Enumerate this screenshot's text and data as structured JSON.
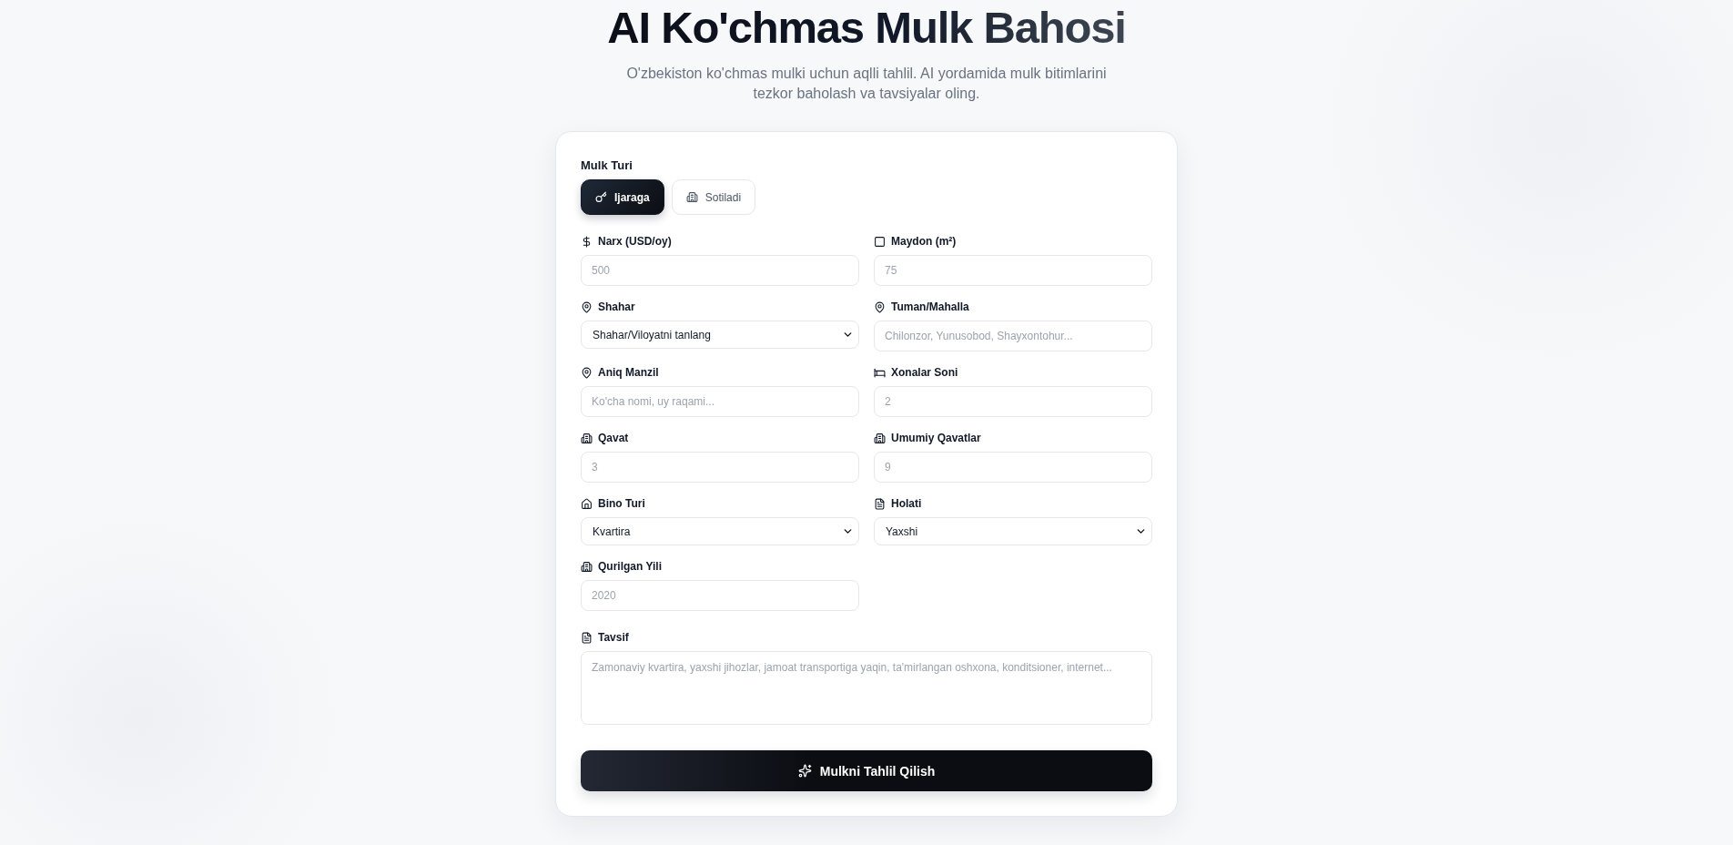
{
  "header": {
    "title": "AI Ko'chmas Mulk Bahosi",
    "subtitle": "O'zbekiston ko'chmas mulki uchun aqlli tahlil. AI yordamida mulk bitimlarini tezkor baholash va tavsiyalar oling."
  },
  "form": {
    "property_type": {
      "label": "Mulk Turi",
      "options": [
        {
          "label": "Ijaraga",
          "selected": true
        },
        {
          "label": "Sotiladi",
          "selected": false
        }
      ]
    },
    "fields": [
      {
        "kind": "input",
        "label": "Narx (USD/oy)",
        "placeholder": "500"
      },
      {
        "kind": "input",
        "label": "Maydon (m²)",
        "placeholder": "75"
      },
      {
        "kind": "select",
        "label": "Shahar",
        "value": "Shahar/Viloyatni tanlang"
      },
      {
        "kind": "input",
        "label": "Tuman/Mahalla",
        "placeholder": "Chilonzor, Yunusobod, Shayxontohur..."
      },
      {
        "kind": "input",
        "label": "Aniq Manzil",
        "placeholder": "Ko'cha nomi, uy raqami..."
      },
      {
        "kind": "input",
        "label": "Xonalar Soni",
        "placeholder": "2"
      },
      {
        "kind": "input",
        "label": "Qavat",
        "placeholder": "3"
      },
      {
        "kind": "input",
        "label": "Umumiy Qavatlar",
        "placeholder": "9"
      },
      {
        "kind": "select",
        "label": "Bino Turi",
        "value": "Kvartira"
      },
      {
        "kind": "select",
        "label": "Holati",
        "value": "Yaxshi"
      },
      {
        "kind": "input",
        "label": "Qurilgan Yili",
        "placeholder": "2020"
      }
    ],
    "description": {
      "label": "Tavsif",
      "placeholder": "Zamonaviy kvartira, yaxshi jihozlar, jamoat transportiga yaqin, ta'mirlangan oshxona, konditsioner, internet..."
    },
    "submit": {
      "label": "Mulkni Tahlil Qilish"
    }
  }
}
